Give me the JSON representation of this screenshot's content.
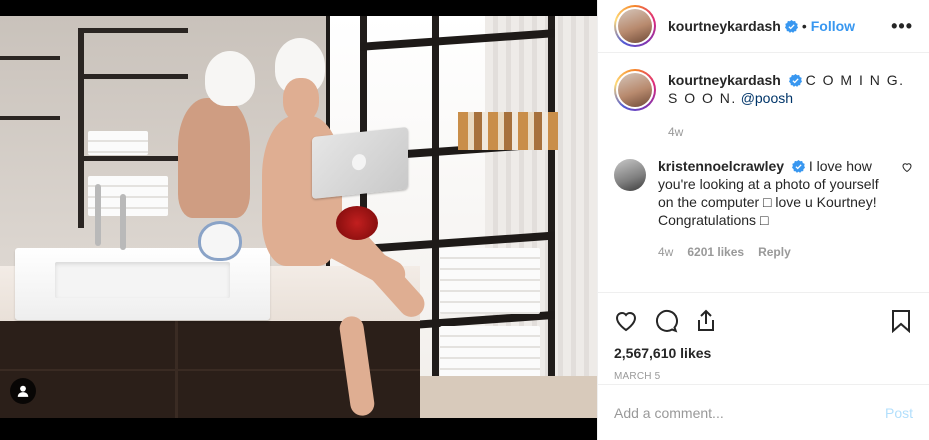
{
  "post": {
    "author": {
      "username": "kourtneykardash",
      "verified": true,
      "follow_label": "Follow",
      "separator": "•",
      "more_label": "•••"
    },
    "caption": {
      "username": "kourtneykardash",
      "text": "C O M I N G. S O O N.",
      "mention": "@poosh",
      "age": "4w"
    },
    "comments": [
      {
        "username": "kristennoelcrawley",
        "text": "I love how you're looking at a photo of yourself on the computer □ love u Kourtney! Congratulations □",
        "age": "4w",
        "likes": "6201 likes",
        "reply_label": "Reply"
      }
    ],
    "likes_count": "2,567,610 likes",
    "date": "MARCH 5",
    "add_comment_placeholder": "Add a comment...",
    "post_label": "Post",
    "icons": {
      "like": "heart-icon",
      "comment": "comment-bubble-icon",
      "share": "share-icon",
      "save": "bookmark-icon",
      "tags": "user-tag-icon",
      "verified": "verified-badge-icon"
    },
    "colors": {
      "link_blue": "#3897f0",
      "verified_blue": "#3897f0",
      "muted": "#999999",
      "post_disabled": "#b2dffc"
    }
  }
}
